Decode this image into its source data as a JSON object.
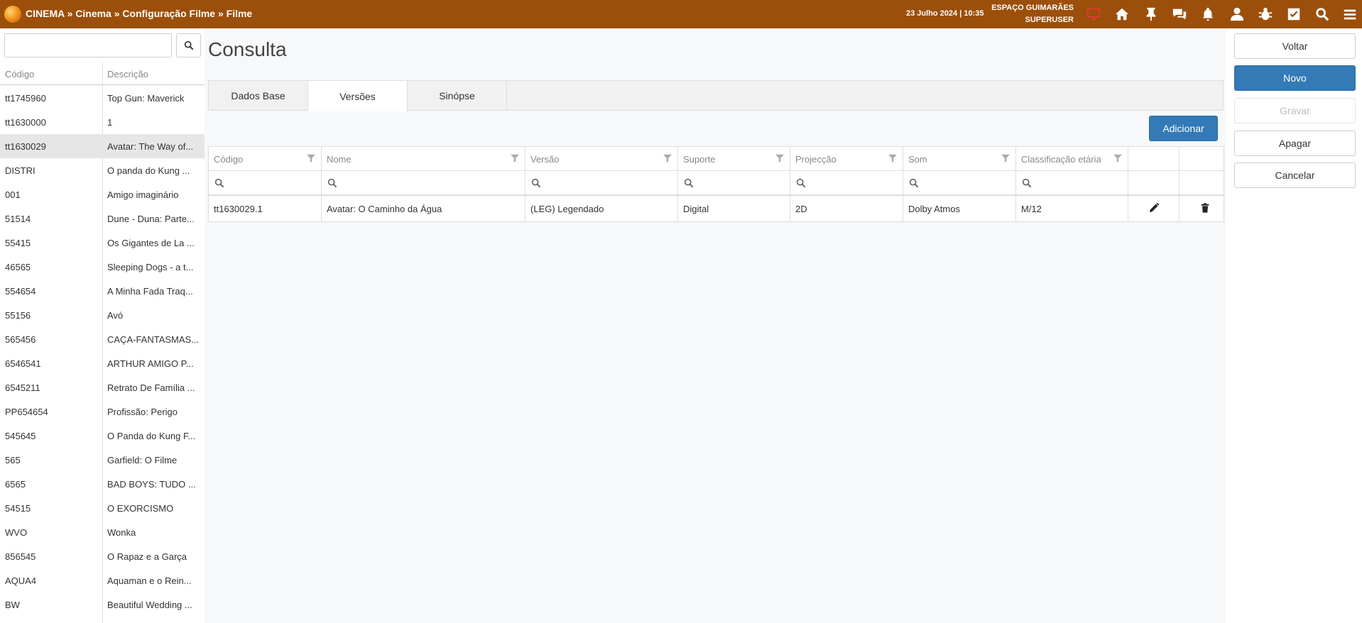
{
  "topbar": {
    "breadcrumb": "CINEMA » Cinema » Configuração Filme » Filme",
    "datetime": "23 Julho 2024 | 10:35",
    "location": "ESPAÇO GUIMARÃES",
    "user": "SUPERUSER",
    "icons": [
      "monitor-icon",
      "home-icon",
      "pin-icon",
      "chat-icon",
      "bell-icon",
      "user-icon",
      "bug-icon",
      "checkbox-icon",
      "search-icon",
      "menu-icon"
    ],
    "monitor_color": "#e53935"
  },
  "left": {
    "search_placeholder": "",
    "headers": {
      "code": "Código",
      "description": "Descrição"
    },
    "items": [
      {
        "code": "tt1745960",
        "description": "Top Gun: Maverick"
      },
      {
        "code": "tt1630000",
        "description": "1"
      },
      {
        "code": "tt1630029",
        "description": "Avatar: The Way of...",
        "selected": true
      },
      {
        "code": "DISTRI",
        "description": "O panda do Kung ..."
      },
      {
        "code": "001",
        "description": "Amigo imaginário"
      },
      {
        "code": "51514",
        "description": "Dune - Duna: Parte..."
      },
      {
        "code": "55415",
        "description": "Os Gigantes de La ..."
      },
      {
        "code": "46565",
        "description": "Sleeping Dogs - a t..."
      },
      {
        "code": "554654",
        "description": "A Minha Fada Traq..."
      },
      {
        "code": "55156",
        "description": "Avó"
      },
      {
        "code": "565456",
        "description": "CAÇA-FANTASMAS..."
      },
      {
        "code": "6546541",
        "description": "ARTHUR AMIGO P..."
      },
      {
        "code": "6545211",
        "description": "Retrato De Família ..."
      },
      {
        "code": "PP654654",
        "description": "Profissão: Perigo"
      },
      {
        "code": "545645",
        "description": "O Panda do Kung F..."
      },
      {
        "code": "565",
        "description": "Garfield: O Filme"
      },
      {
        "code": "6565",
        "description": "BAD BOYS: TUDO ..."
      },
      {
        "code": "54515",
        "description": "O EXORCISMO"
      },
      {
        "code": "WVO",
        "description": "Wonka"
      },
      {
        "code": "856545",
        "description": "O Rapaz e a Garça"
      },
      {
        "code": "AQUA4",
        "description": "Aquaman e o Rein..."
      },
      {
        "code": "BW",
        "description": "Beautiful Wedding ..."
      }
    ]
  },
  "main": {
    "title": "Consulta",
    "tabs": [
      {
        "label": "Dados Base",
        "active": false
      },
      {
        "label": "Versões",
        "active": true
      },
      {
        "label": "Sinópse",
        "active": false
      }
    ],
    "add_button": "Adicionar",
    "table": {
      "columns": [
        "Código",
        "Nome",
        "Versão",
        "Suporte",
        "Projecção",
        "Som",
        "Classificação etária"
      ],
      "rows": [
        [
          "tt1630029.1",
          "Avatar: O Caminho da Água",
          "(LEG) Legendado",
          "Digital",
          "2D",
          "Dolby Atmos",
          "M/12"
        ]
      ]
    }
  },
  "right": {
    "buttons": [
      {
        "label": "Voltar",
        "style": "default"
      },
      {
        "label": "Novo",
        "style": "primary"
      },
      {
        "label": "Gravar",
        "style": "disabled"
      },
      {
        "label": "Apagar",
        "style": "default"
      },
      {
        "label": "Cancelar",
        "style": "default"
      }
    ]
  },
  "colors": {
    "topbar": "#9c4f0a",
    "primary": "#337ab7",
    "selected_row": "#e6e6e6"
  }
}
